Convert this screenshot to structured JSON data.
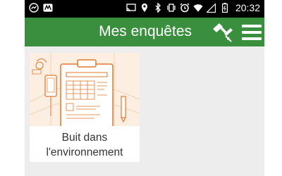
{
  "status_bar": {
    "time": "20:32",
    "left_icons": [
      "messenger-icon",
      "notification-logo-icon"
    ],
    "right_icons": [
      "cast-icon",
      "location-icon",
      "bluetooth-icon",
      "vibrate-icon",
      "alarm-icon",
      "wifi-icon",
      "signal-icon",
      "battery-icon"
    ]
  },
  "app_bar": {
    "title": "Mes enquêtes",
    "color": "#3a8f3e",
    "actions": [
      "satellite-icon",
      "hamburger-menu-icon"
    ]
  },
  "surveys": [
    {
      "title": "Buit dans l'environnement",
      "thumbnail": "survey-clipboard-illustration"
    }
  ]
}
